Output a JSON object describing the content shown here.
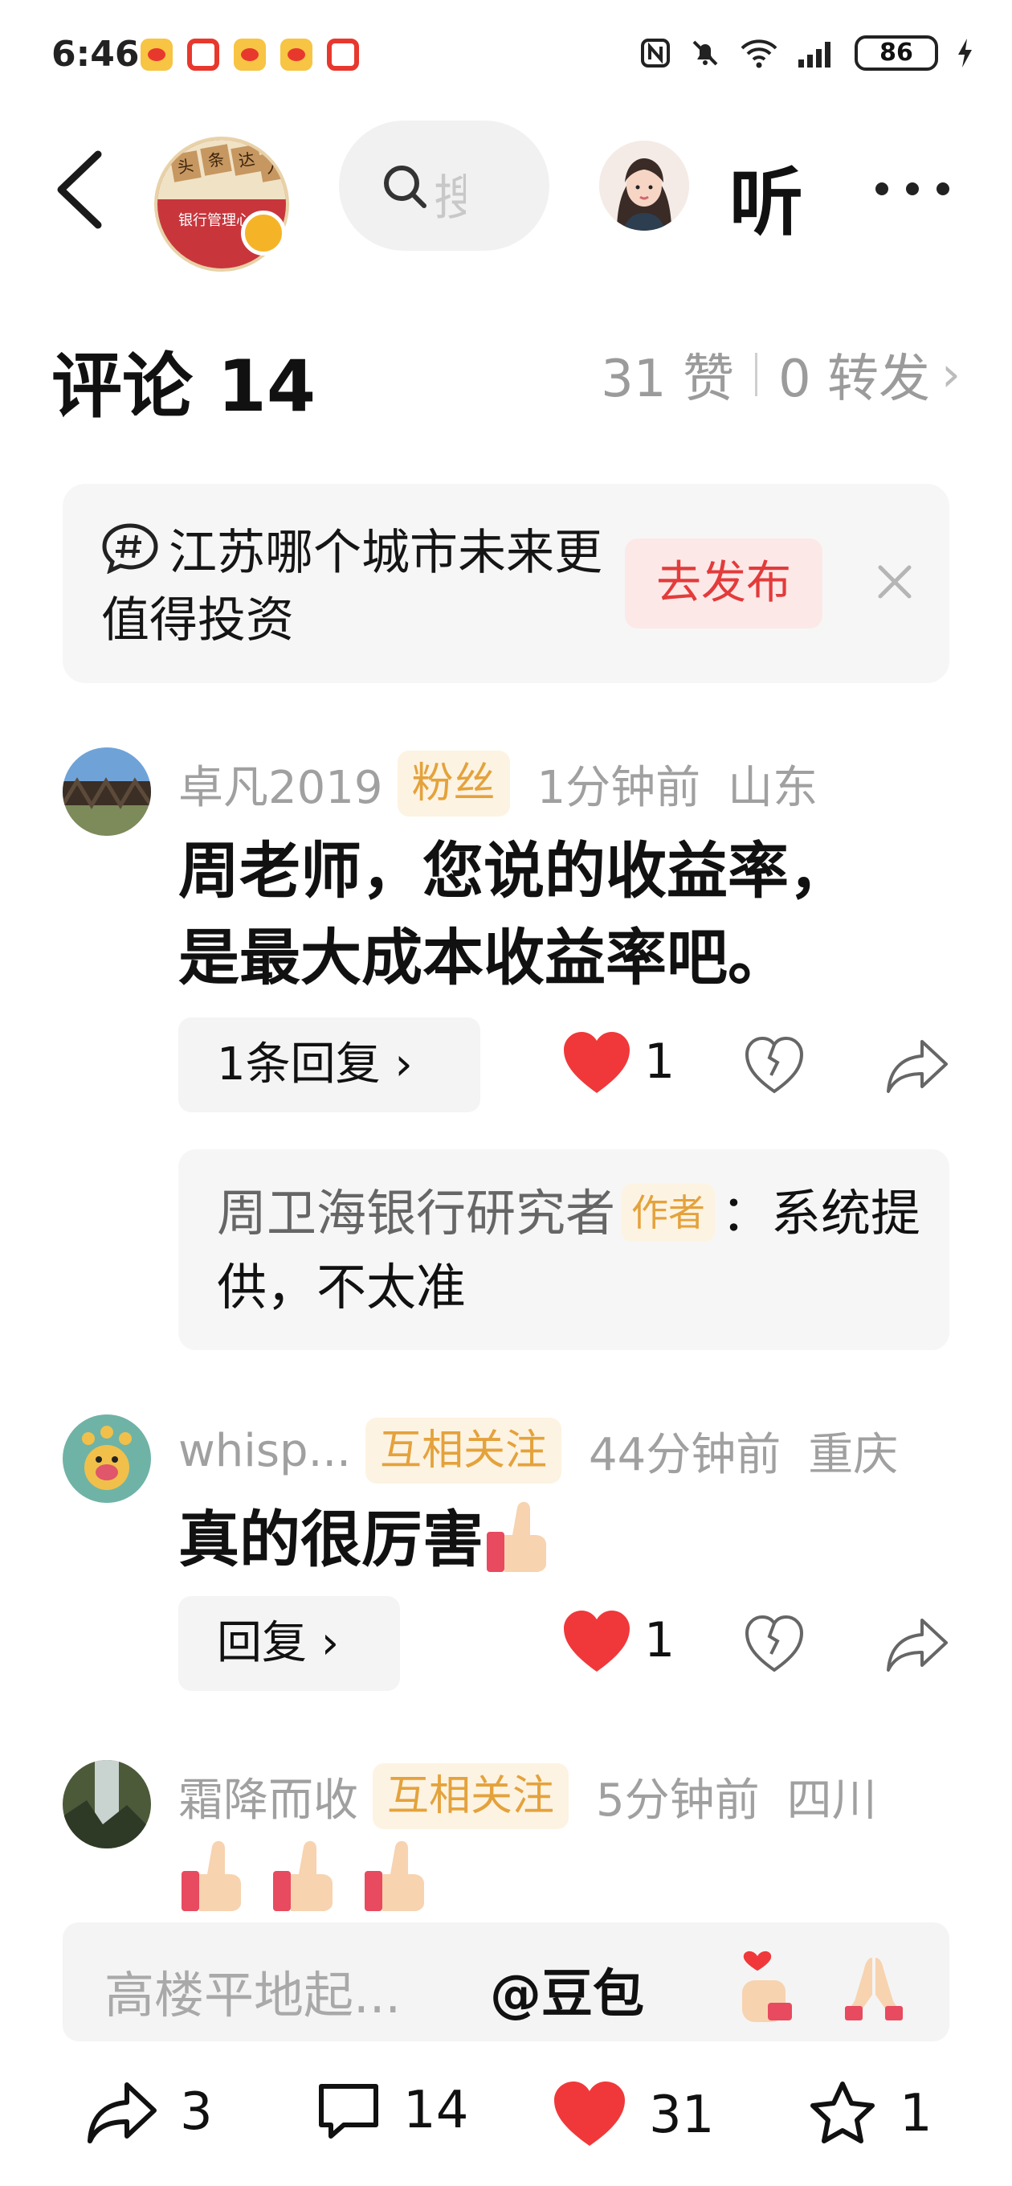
{
  "status_bar": {
    "time": "6:46",
    "battery": "86"
  },
  "header": {
    "cover_tags": [
      "头",
      "条",
      "达",
      "人"
    ],
    "cover_title": "银行管理心语",
    "search_hint": "搜",
    "listen_label": "听"
  },
  "comments_header": {
    "title": "评论 14",
    "likes": "31 赞",
    "forwards": "0 转发",
    "chevron": "›"
  },
  "topic": {
    "text": "江苏哪个城市未来更值得投资",
    "publish_label": "去发布"
  },
  "comments": [
    {
      "username": "卓凡2019",
      "badge": "粉丝",
      "time": "1分钟前",
      "location": "山东",
      "text_line1": "周老师，您说的收益率，",
      "text_line2": "是最大成本收益率吧。",
      "reply_label": "1条回复 ›",
      "like_count": "1",
      "author_reply": {
        "name": "周卫海银行研究者",
        "badge": "作者",
        "text": "：系统提供，不太准"
      }
    },
    {
      "username": "whisp...",
      "badge": "互相关注",
      "time": "44分钟前",
      "location": "重庆",
      "text": "真的很厉害",
      "reply_label": "回复 ›",
      "like_count": "1"
    },
    {
      "username": "霜降而收",
      "badge": "互相关注",
      "time": "5分钟前",
      "location": "四川",
      "emojis": [
        "thumbs-up",
        "thumbs-up",
        "thumbs-up"
      ]
    }
  ],
  "input_bar": {
    "placeholder": "高楼平地起...",
    "mention": "@豆包"
  },
  "bottom_bar": {
    "share_count": "3",
    "comment_count": "14",
    "like_count": "31",
    "favorite_count": "1"
  },
  "colors": {
    "accent_red": "#e33b3b",
    "heart_red": "#f0383a",
    "badge_bg": "#fdf3e2",
    "badge_text": "#e4a23c",
    "muted_text": "#a0a0a0"
  }
}
